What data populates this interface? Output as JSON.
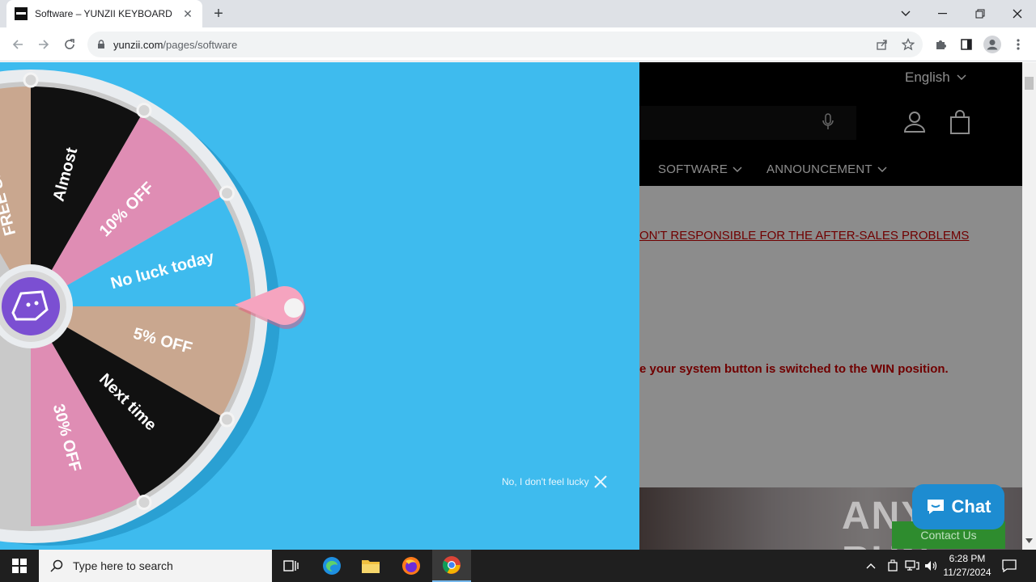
{
  "browser": {
    "tab_title": "Software – YUNZII KEYBOARD",
    "url_domain": "yunzii.com",
    "url_path": "/pages/software"
  },
  "site": {
    "language": "English",
    "nav": [
      "SOFTWARE",
      "ANNOUNCEMENT"
    ],
    "notice_1": "ON'T RESPONSIBLE FOR THE AFTER-SALES PROBLEMS",
    "notice_2": "e your system button is switched to the WIN position.",
    "chat_label": "Chat",
    "contact_label": "Contact Us"
  },
  "wheel": {
    "segments": [
      "FREE SHIPPING",
      "Almost",
      "10% OFF",
      "No luck today",
      "5% OFF",
      "Next time",
      "30% OFF"
    ],
    "colors": {
      "tan": "#c9a78f",
      "black": "#111111",
      "pink": "#df8db4",
      "blue": "#3ebbee",
      "purple": "#7b4fd2"
    },
    "dismiss_label": "No, I don't feel lucky"
  },
  "watermark": "ANY RUN",
  "taskbar": {
    "search_placeholder": "Type here to search",
    "time": "6:28 PM",
    "date": "11/27/2024"
  }
}
